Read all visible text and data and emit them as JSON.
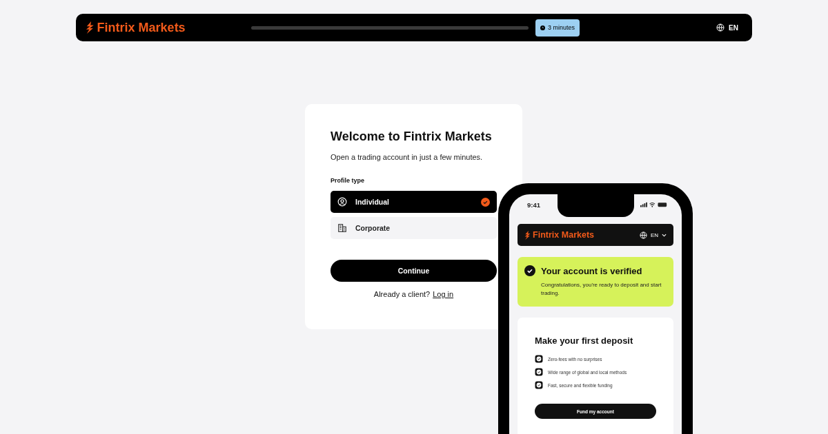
{
  "header": {
    "brand": "Fintrix Markets",
    "progress": {
      "level": 0
    },
    "time_badge": "3 minutes",
    "language": "EN"
  },
  "signup": {
    "title": "Welcome to Fintrix Markets",
    "subtitle": "Open a trading account in just a few minutes.",
    "profile_label": "Profile type",
    "options": [
      {
        "label": "Individual",
        "kind": "person",
        "selected": true
      },
      {
        "label": "Corporate",
        "kind": "building",
        "selected": false
      }
    ],
    "continue_button": "Continue",
    "login_prompt": "Already a client?",
    "login_link": "Log in"
  },
  "phone": {
    "time": "9:41",
    "brand": "Fintrix Markets",
    "language": "EN",
    "verified": {
      "title": "Your account is verified",
      "text": "Congratulations, you're ready to deposit and start trading."
    },
    "deposit": {
      "title": "Make your first deposit",
      "features": [
        {
          "label": "Zero-fees with no surprises",
          "checked": true
        },
        {
          "label": "Wide range of global and local methods",
          "checked": true
        },
        {
          "label": "Fast, secure and flexible funding",
          "checked": true
        }
      ],
      "button": "Fund my account"
    }
  }
}
